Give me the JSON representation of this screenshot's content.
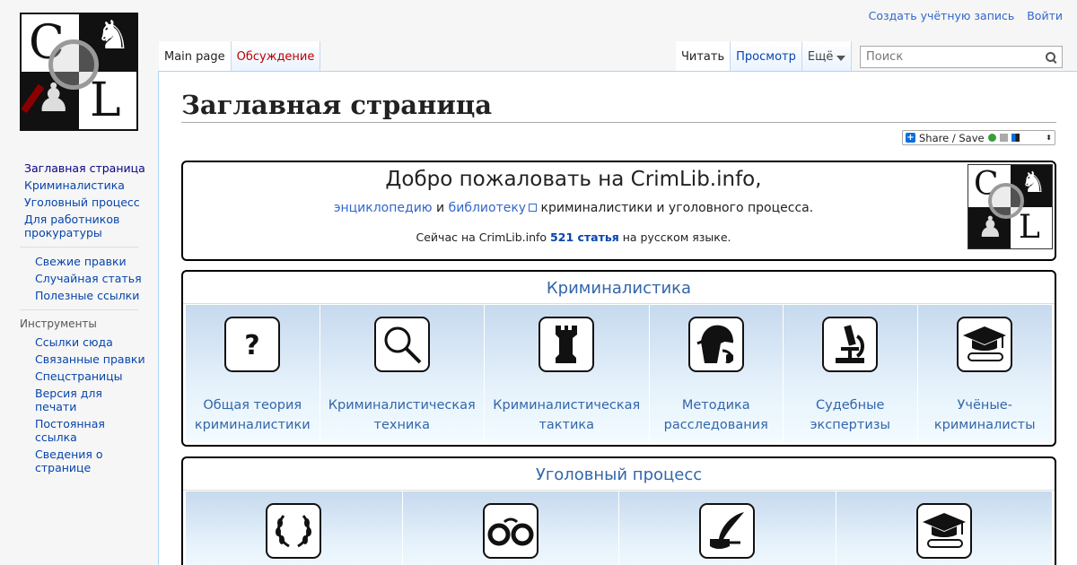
{
  "logo": {
    "letter1": "C",
    "letter2": "L"
  },
  "personal": {
    "create_account": "Создать учётную запись",
    "login": "Войти"
  },
  "tabs": {
    "main_page": "Main page",
    "discussion": "Обсуждение",
    "read": "Читать",
    "view": "Просмотр",
    "more": "Ещё"
  },
  "search": {
    "placeholder": "Поиск"
  },
  "sidebar": {
    "nav": [
      "Заглавная страница",
      "Криминалистика",
      "Уголовный процесс",
      "Для работников прокуратуры"
    ],
    "nav2": [
      "Свежие правки",
      "Случайная статья",
      "Полезные ссылки"
    ],
    "tools_heading": "Инструменты",
    "tools": [
      "Ссылки сюда",
      "Связанные правки",
      "Спецстраницы",
      "Версия для печати",
      "Постоянная ссылка",
      "Сведения о странице"
    ]
  },
  "page": {
    "title": "Заглавная страница",
    "share": "Share / Save"
  },
  "welcome": {
    "heading": "Добро пожаловать на CrimLib.info,",
    "link1": "энциклопедию",
    "and": "и",
    "link2": "библиотеку",
    "rest": "криминалистики и уголовного процесса.",
    "stat_pre": "Сейчас на CrimLib.info",
    "stat_count": "521 статья",
    "stat_post": "на русском языке."
  },
  "krim": {
    "title": "Криминалистика",
    "items": [
      {
        "label": "Общая теория криминалистики",
        "icon": "question-icon"
      },
      {
        "label": "Криминалистическая техника",
        "icon": "magnifier-icon"
      },
      {
        "label": "Криминалистическая тактика",
        "icon": "rook-icon"
      },
      {
        "label": "Методика расследования",
        "icon": "detective-icon"
      },
      {
        "label": "Судебные экспертизы",
        "icon": "microscope-icon"
      },
      {
        "label": "Учёные-криминалисты",
        "icon": "graduation-cap-icon"
      }
    ]
  },
  "ugol": {
    "title": "Уголовный процесс",
    "items": [
      {
        "icon": "laurel-icon"
      },
      {
        "icon": "handcuffs-icon"
      },
      {
        "icon": "quill-icon"
      },
      {
        "icon": "graduation-cap-icon"
      }
    ]
  },
  "colors": {
    "link": "#0645ad",
    "section": "#3366aa",
    "discussion": "#ba0000"
  }
}
